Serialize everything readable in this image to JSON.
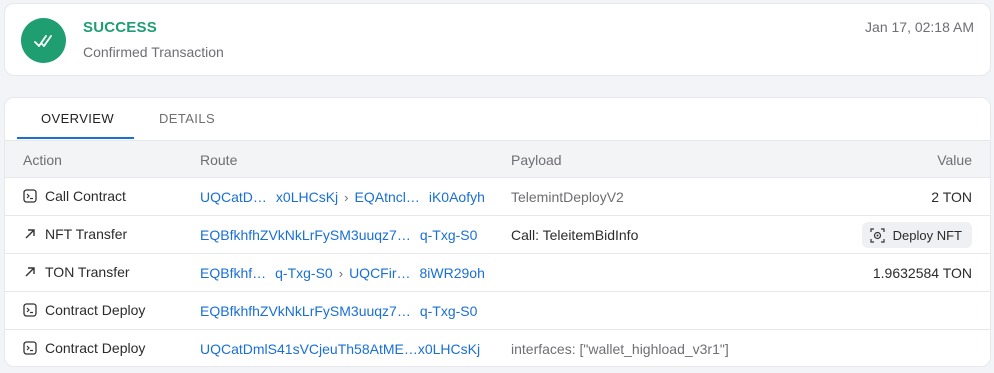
{
  "status": {
    "title": "SUCCESS",
    "subtitle": "Confirmed Transaction",
    "timestamp": "Jan 17, 02:18 AM",
    "icon": "double-check-icon",
    "color": "#1f9e72"
  },
  "tabs": [
    {
      "label": "OVERVIEW",
      "active": true
    },
    {
      "label": "DETAILS",
      "active": false
    }
  ],
  "columns": {
    "action": "Action",
    "route": "Route",
    "payload": "Payload",
    "value": "Value"
  },
  "rows": [
    {
      "icon": "terminal-icon",
      "action": "Call Contract",
      "route_from_a": "UQCatD…",
      "route_from_b": "x0LHCsKj",
      "route_to_a": "EQAtncl…",
      "route_to_b": "iK0Aofyh",
      "payload": "TelemintDeployV2",
      "value": "2 TON"
    },
    {
      "icon": "arrow-up-right-icon",
      "action": "NFT Transfer",
      "route_a": "EQBfkhfhZVkNkLrFySM3uuqz7…",
      "route_b": "q-Txg-S0",
      "payload": "Call: TeleitemBidInfo",
      "button": "Deploy NFT"
    },
    {
      "icon": "arrow-up-right-icon",
      "action": "TON Transfer",
      "route_from_a": "EQBfkhf…",
      "route_from_b": "q-Txg-S0",
      "route_to_a": "UQCFir…",
      "route_to_b": "8iWR29oh",
      "payload": "",
      "value": "1.9632584 TON"
    },
    {
      "icon": "terminal-icon",
      "action": "Contract Deploy",
      "route_a": "EQBfkhfhZVkNkLrFySM3uuqz7…",
      "route_b": "q-Txg-S0",
      "payload": "",
      "value": ""
    },
    {
      "icon": "terminal-icon",
      "action": "Contract Deploy",
      "route_a": "UQCatDmlS41sVCjeuTh58AtME…",
      "route_b": "x0LHCsKj",
      "payload": "interfaces: [\"wallet_highload_v3r1\"]",
      "value": ""
    }
  ]
}
